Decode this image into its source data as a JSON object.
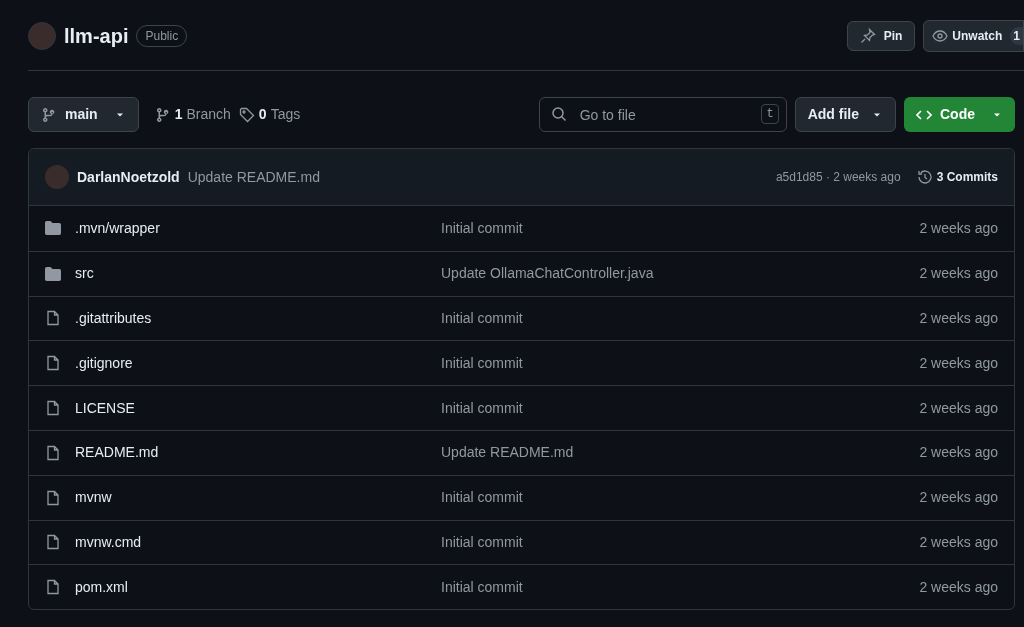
{
  "repo": {
    "name": "llm-api",
    "visibility": "Public"
  },
  "actions": {
    "pin": "Pin",
    "watch": "Unwatch",
    "watch_count": "1"
  },
  "toolbar": {
    "branch": "main",
    "branches_count": "1",
    "branches_label": "Branch",
    "tags_count": "0",
    "tags_label": "Tags",
    "search_placeholder": "Go to file",
    "search_key": "t",
    "add_file": "Add file",
    "code": "Code"
  },
  "latest_commit": {
    "author": "DarlanNoetzold",
    "message": "Update README.md",
    "hash_time": "a5d1d85 · 2 weeks ago",
    "commits": "3 Commits"
  },
  "files": [
    {
      "kind": "folder",
      "name": ".mvn/wrapper",
      "message": "Initial commit",
      "time": "2 weeks ago"
    },
    {
      "kind": "folder",
      "name": "src",
      "message": "Update OllamaChatController.java",
      "time": "2 weeks ago"
    },
    {
      "kind": "file",
      "name": ".gitattributes",
      "message": "Initial commit",
      "time": "2 weeks ago"
    },
    {
      "kind": "file",
      "name": ".gitignore",
      "message": "Initial commit",
      "time": "2 weeks ago"
    },
    {
      "kind": "file",
      "name": "LICENSE",
      "message": "Initial commit",
      "time": "2 weeks ago"
    },
    {
      "kind": "file",
      "name": "README.md",
      "message": "Update README.md",
      "time": "2 weeks ago"
    },
    {
      "kind": "file",
      "name": "mvnw",
      "message": "Initial commit",
      "time": "2 weeks ago"
    },
    {
      "kind": "file",
      "name": "mvnw.cmd",
      "message": "Initial commit",
      "time": "2 weeks ago"
    },
    {
      "kind": "file",
      "name": "pom.xml",
      "message": "Initial commit",
      "time": "2 weeks ago"
    }
  ]
}
